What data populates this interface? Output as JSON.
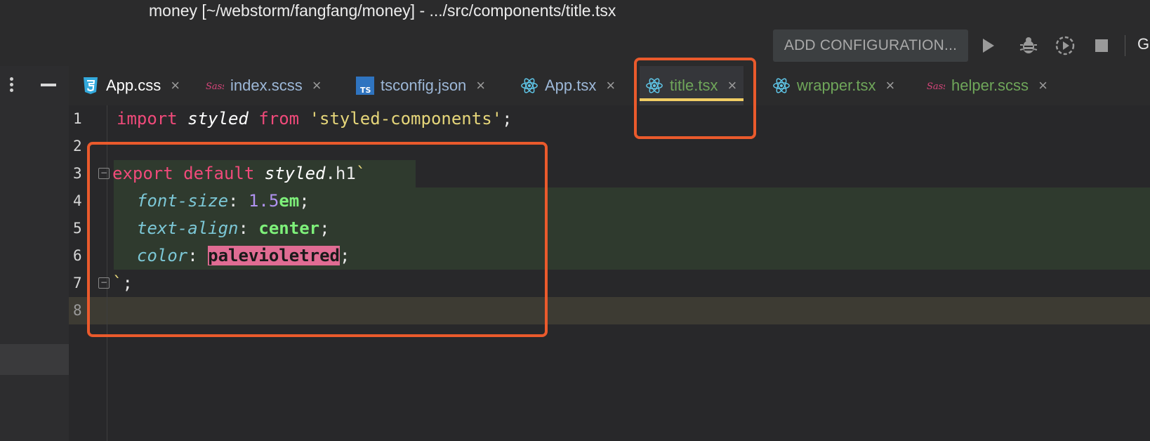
{
  "window": {
    "title": "money [~/webstorm/fangfang/money] - .../src/components/title.tsx"
  },
  "toolbar": {
    "add_config": "ADD CONFIGURATION...",
    "icons": [
      "run-icon",
      "debug-icon",
      "run-coverage-icon",
      "stop-icon"
    ],
    "truncated_label": "G"
  },
  "tabs": [
    {
      "label": "App.css",
      "icon": "css-icon",
      "active": false
    },
    {
      "label": "index.scss",
      "icon": "sass-icon",
      "active": false
    },
    {
      "label": "tsconfig.json",
      "icon": "typescript-icon",
      "active": false
    },
    {
      "label": "App.tsx",
      "icon": "react-icon",
      "active": false
    },
    {
      "label": "title.tsx",
      "icon": "react-icon",
      "active": true
    },
    {
      "label": "wrapper.tsx",
      "icon": "react-icon",
      "active": false
    },
    {
      "label": "helper.scss",
      "icon": "sass-icon",
      "active": false
    }
  ],
  "tab_close": "×",
  "editor": {
    "line_numbers": [
      "1",
      "2",
      "3",
      "4",
      "5",
      "6",
      "7",
      "8"
    ],
    "lines": [
      {
        "kw": "import",
        "id": "styled",
        "kw2": "from",
        "str": "'styled-components'",
        "end": ";"
      },
      {},
      {
        "kw": "export",
        "kw2": "default",
        "obj": "styled",
        "dot": ".h1",
        "tick": "`"
      },
      {
        "prop": "font-size",
        "colon": ": ",
        "num": "1.5",
        "unit": "em",
        "end": ";"
      },
      {
        "prop": "text-align",
        "colon": ": ",
        "val": "center",
        "end": ";"
      },
      {
        "prop": "color",
        "colon": ": ",
        "val": "palevioletred",
        "end": ";"
      },
      {
        "tick": "`",
        "end": ";"
      },
      {}
    ]
  },
  "colors": {
    "annotation": "#ea5a2c",
    "active_tab_underline": "#f0cd64",
    "keyword": "#f04a7a"
  }
}
